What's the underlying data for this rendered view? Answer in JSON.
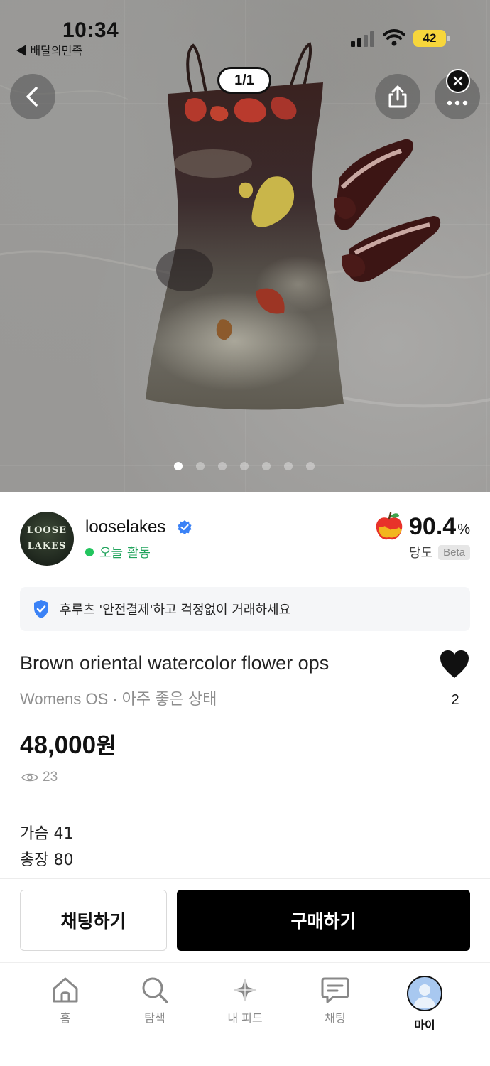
{
  "status_bar": {
    "time": "10:34",
    "back_app": "◀ 배달의민족",
    "battery": "42"
  },
  "gallery": {
    "counter": "1/1",
    "dot_count": 7,
    "active_dot": 0
  },
  "seller": {
    "avatar_text_line1": "LOOSE",
    "avatar_text_line2": "LAKES",
    "name": "looselakes",
    "activity": "오늘 활동",
    "score": "90.4",
    "score_unit": "%",
    "score_label": "당도",
    "score_badge": "Beta"
  },
  "safe_banner": "후루츠 '안전결제'하고 걱정없이 거래하세요",
  "product": {
    "title": "Brown oriental watercolor flower ops",
    "category": "Womens OS",
    "separator": "·",
    "condition": "아주 좋은 상태",
    "like_count": "2",
    "price": "48,000",
    "price_unit": "원",
    "views": "23",
    "desc_line1": "가슴 41",
    "desc_line2": "총장 80"
  },
  "actions": {
    "chat": "채팅하기",
    "buy": "구매하기"
  },
  "nav": {
    "home": "홈",
    "search": "탐색",
    "feed": "내 피드",
    "chat": "채팅",
    "my": "마이"
  },
  "colors": {
    "active_green": "#22c55e",
    "verified_blue": "#3b82f6",
    "buy_button": "#000000",
    "battery_yellow": "#f7d63b"
  }
}
